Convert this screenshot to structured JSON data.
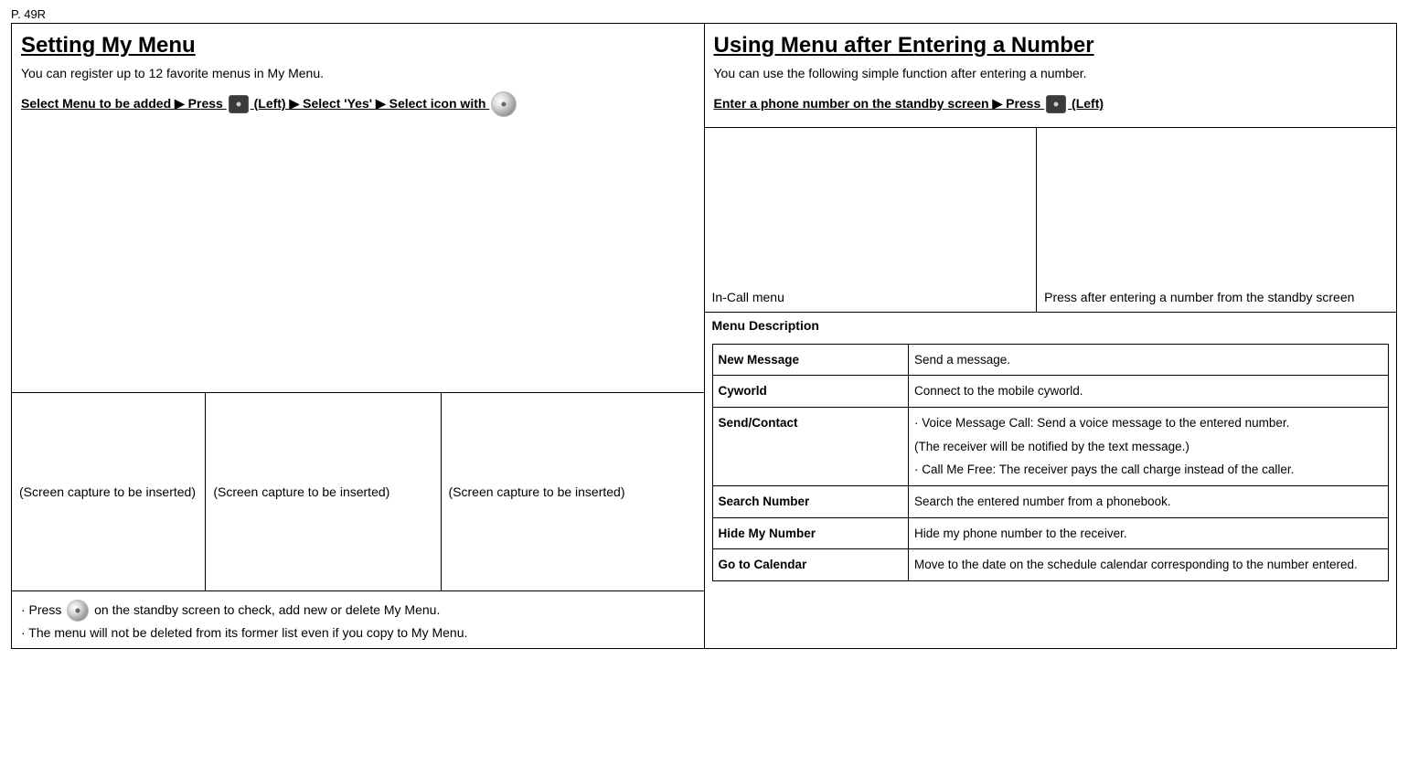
{
  "page": {
    "label": "P. 49R"
  },
  "left": {
    "heading": "Setting My Menu",
    "desc": "You can register up to 12 favorite menus in My Menu.",
    "instr_pre": "Select Menu to be added ▶ Press ",
    "instr_post": " (Left) ▶ Select 'Yes' ▶ Select icon with ",
    "screencap": "(Screen capture to be inserted)",
    "note1_pre": "· Press ",
    "note1_post": " on the standby screen to check, add new or delete My Menu.",
    "note2": "· The menu will not be deleted from its former list even if you copy to My Menu."
  },
  "right": {
    "heading": "Using Menu after Entering a Number",
    "desc": "You can use the following simple function after entering a number.",
    "instr_pre": "Enter a phone number on the standby screen ▶ Press ",
    "instr_post": " (Left)",
    "col1": "In-Call menu",
    "col2": "Press after entering a number from the standby screen",
    "menu_title": "Menu Description",
    "rows": [
      {
        "k": "New Message",
        "v": "Send a message."
      },
      {
        "k": "Cyworld",
        "v": "Connect to the mobile cyworld."
      },
      {
        "k": "Send/Contact",
        "v": "· Voice Message Call: Send a voice message to the entered number.\n(The receiver will be notified by the text message.)\n· Call Me Free: The receiver pays the call charge instead of the caller."
      },
      {
        "k": "Search Number",
        "v": "Search the entered number from a phonebook."
      },
      {
        "k": "Hide My Number",
        "v": "Hide my phone number to the receiver."
      },
      {
        "k": "Go to Calendar",
        "v": "Move to the date on the schedule calendar corresponding to the number entered."
      }
    ]
  }
}
